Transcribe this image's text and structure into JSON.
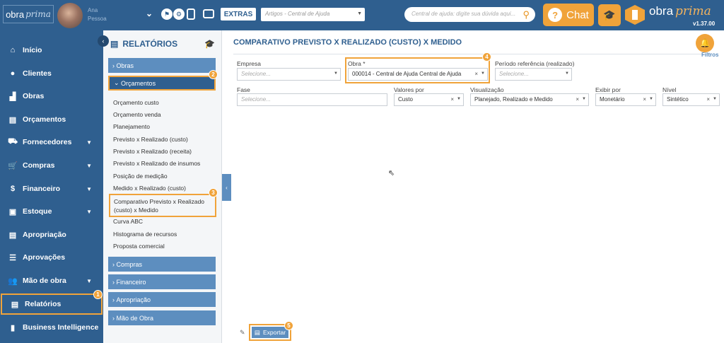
{
  "topbar": {
    "logo_a": "obra",
    "logo_b": "prima",
    "user_line1": "Ana",
    "user_line2": "Pessoa",
    "extras_label": "EXTRAS",
    "article_placeholder": "Artigos - Central de Ajuda",
    "search_placeholder": "Central de ajuda: digite sua dúvida aqui...",
    "chat_label": "Chat",
    "brand_a": "obra",
    "brand_b": "prima",
    "version": "v1.37.00"
  },
  "sidebar": {
    "items": [
      {
        "label": "Início",
        "icon": "home-icon"
      },
      {
        "label": "Clientes",
        "icon": "user-icon"
      },
      {
        "label": "Obras",
        "icon": "building-icon"
      },
      {
        "label": "Orçamentos",
        "icon": "document-icon"
      },
      {
        "label": "Fornecedores",
        "icon": "truck-icon"
      },
      {
        "label": "Compras",
        "icon": "cart-icon"
      },
      {
        "label": "Financeiro",
        "icon": "dollar-icon"
      },
      {
        "label": "Estoque",
        "icon": "box-icon"
      },
      {
        "label": "Apropriação",
        "icon": "document-icon"
      },
      {
        "label": "Aprovações",
        "icon": "list-check-icon"
      },
      {
        "label": "Mão de obra",
        "icon": "users-icon"
      },
      {
        "label": "Relatórios",
        "icon": "report-icon"
      },
      {
        "label": "Business Intelligence",
        "icon": "bar-chart-icon"
      }
    ]
  },
  "panel": {
    "title": "RELATÓRIOS",
    "groups": {
      "obras": "Obras",
      "orcamentos": "Orçamentos",
      "compras": "Compras",
      "financeiro": "Financeiro",
      "apropriacao": "Apropriação",
      "mao_de_obra": "Mão de Obra"
    },
    "subitems": [
      "Orçamento custo",
      "Orçamento venda",
      "Planejamento",
      "Previsto x Realizado (custo)",
      "Previsto x Realizado (receita)",
      "Previsto x Realizado de insumos",
      "Posição de medição",
      "Medido x Realizado (custo)",
      "Comparativo Previsto x Realizado (custo) x Medido",
      "Curva ABC",
      "Histograma de recursos",
      "Proposta comercial"
    ]
  },
  "badges": [
    "1",
    "2",
    "3",
    "4",
    "5"
  ],
  "main": {
    "title": "COMPARATIVO PREVISTO X REALIZADO (CUSTO) X MEDIDO",
    "filters_label": "Filtros",
    "fields": {
      "empresa": {
        "label": "Empresa",
        "placeholder": "Selecione..."
      },
      "obra": {
        "label": "Obra *",
        "value": "000014 - Central de Ajuda Central de Ajuda"
      },
      "periodo": {
        "label": "Período referência (realizado)",
        "placeholder": "Selecione..."
      },
      "fase": {
        "label": "Fase",
        "placeholder": "Selecione..."
      },
      "valores": {
        "label": "Valores por",
        "value": "Custo"
      },
      "visualizacao": {
        "label": "Visualização",
        "value": "Planejado, Realizado e Medido"
      },
      "exibir": {
        "label": "Exibir por",
        "value": "Monetário"
      },
      "nivel": {
        "label": "Nível",
        "value": "Sintético"
      }
    },
    "export_label": "Exportar"
  },
  "colors": {
    "primary": "#2f5f8f",
    "accent": "#f0a33a",
    "group": "#5d8ebf"
  }
}
